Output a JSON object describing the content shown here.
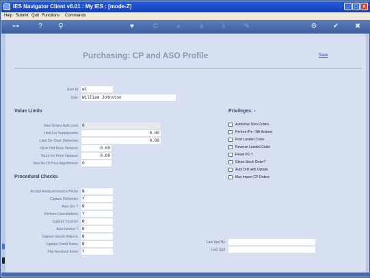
{
  "window": {
    "title": "IES Navigator Client v8.01 : My IES :      [mode-Z]",
    "minimize_label": "_",
    "maximize_label": "□",
    "close_label": "x"
  },
  "menu": {
    "items": [
      "Help",
      "Submit",
      "Quit",
      "Functions",
      "Commands"
    ]
  },
  "toolbar": {
    "icons": [
      "key-icon",
      "help-icon",
      "search-icon",
      "heart-icon",
      "copyright-icon",
      "rewind-icon",
      "fast-forward-icon",
      "download-icon",
      "new-icon",
      "settings-icon",
      "accept-icon",
      "cancel-icon"
    ],
    "glyphs": [
      "⊶",
      "?",
      "⚲",
      "♥",
      "©",
      "«",
      "»",
      "⇩",
      "✎",
      "⚙",
      "✔",
      "✖"
    ]
  },
  "page": {
    "title": "Purchasing: CP and ASO Profile",
    "save_label": "Save"
  },
  "user": {
    "user_id_label": "User Id",
    "user_id_value": "w1",
    "user_label": "User",
    "user_value": "William Johnston"
  },
  "value_limits": {
    "heading": "Value Limits",
    "rows": [
      {
        "label": "New Orders Auth Limit",
        "value": "0"
      },
      {
        "label": "Limit For Supplements",
        "value": "0.00"
      },
      {
        "label": "Limit On 'Over' Deliveries",
        "value": "0.00"
      },
      {
        "label": "%Lim Ord Price Variance",
        "value": "0.00"
      },
      {
        "label": "%Lim Inv Price Variance",
        "value": "0.00"
      },
      {
        "label": "Max No Of Price Adjustments",
        "value": "0"
      }
    ]
  },
  "procedural_checks": {
    "heading": "Procedural Checks",
    "rows": [
      {
        "label": "Accept Reduced Invoice Prices",
        "value": "N"
      },
      {
        "label": "Capture Deliveries",
        "value": "Y"
      },
      {
        "label": "Auto Grv ?",
        "value": "N"
      },
      {
        "label": "Perform Cancellations",
        "value": "Y"
      },
      {
        "label": "Capture Invoices",
        "value": "N"
      },
      {
        "label": "Auto Invoice ?",
        "value": "N"
      },
      {
        "label": "Capture Goods Returns",
        "value": "N"
      },
      {
        "label": "Capture Credit Notes",
        "value": "N"
      },
      {
        "label": "Flat Nonstock Items",
        "value": "Y"
      }
    ]
  },
  "privileges": {
    "heading": "Privileges: -",
    "items": [
      {
        "label": "Authorise Own Orders",
        "checked": false
      },
      {
        "label": "Perform Pe / Wk Actions",
        "checked": false
      },
      {
        "label": "Post Landed Costs",
        "checked": false
      },
      {
        "label": "Reverse Landed Costs",
        "checked": false
      },
      {
        "label": "Reset PO ?",
        "checked": false
      },
      {
        "label": "Glean Stock Order?",
        "checked": false
      },
      {
        "label": "Auth Drill with Update",
        "checked": false
      },
      {
        "label": "May Import CP Orders",
        "checked": false
      }
    ]
  },
  "audit": {
    "last_upd_by_label": "Last Upd By",
    "last_upd_by_value": "",
    "last_upd_label": "Last Upd",
    "last_upd_value": ""
  },
  "colors": {
    "titlebar": "#1f4fcb",
    "content_bg": "#d6e0f1",
    "toolbar": "#4b6dae",
    "link": "#2a3fc8"
  }
}
